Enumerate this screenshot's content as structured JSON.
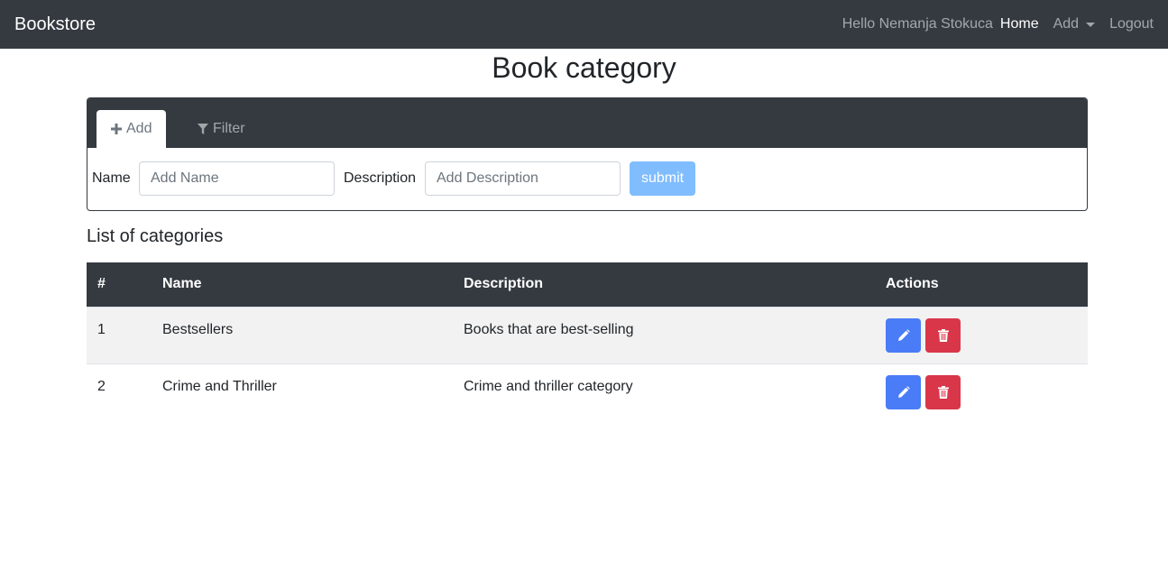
{
  "navbar": {
    "brand": "Bookstore",
    "greeting": "Hello Nemanja Stokuca",
    "home": "Home",
    "add": "Add",
    "logout": "Logout"
  },
  "page": {
    "title": "Book category"
  },
  "panel": {
    "tabs": [
      {
        "label": "Add",
        "icon": "plus-icon",
        "active": true
      },
      {
        "label": "Filter",
        "icon": "filter-icon",
        "active": false
      }
    ],
    "form": {
      "name_label": "Name",
      "name_placeholder": "Add Name",
      "name_value": "",
      "description_label": "Description",
      "description_placeholder": "Add Description",
      "description_value": "",
      "submit_label": "submit"
    }
  },
  "list": {
    "title": "List of categories",
    "columns": [
      "#",
      "Name",
      "Description",
      "Actions"
    ],
    "rows": [
      {
        "id": "1",
        "name": "Bestsellers",
        "description": "Books that are best-selling"
      },
      {
        "id": "2",
        "name": "Crime and Thriller",
        "description": "Crime and thriller category"
      }
    ],
    "action_icons": [
      "pencil-icon",
      "trash-icon"
    ]
  },
  "colors": {
    "navbar_bg": "#343a40",
    "edit_button": "#4a7cf7",
    "delete_button": "#d9364a",
    "submit_button": "#80bdff"
  }
}
